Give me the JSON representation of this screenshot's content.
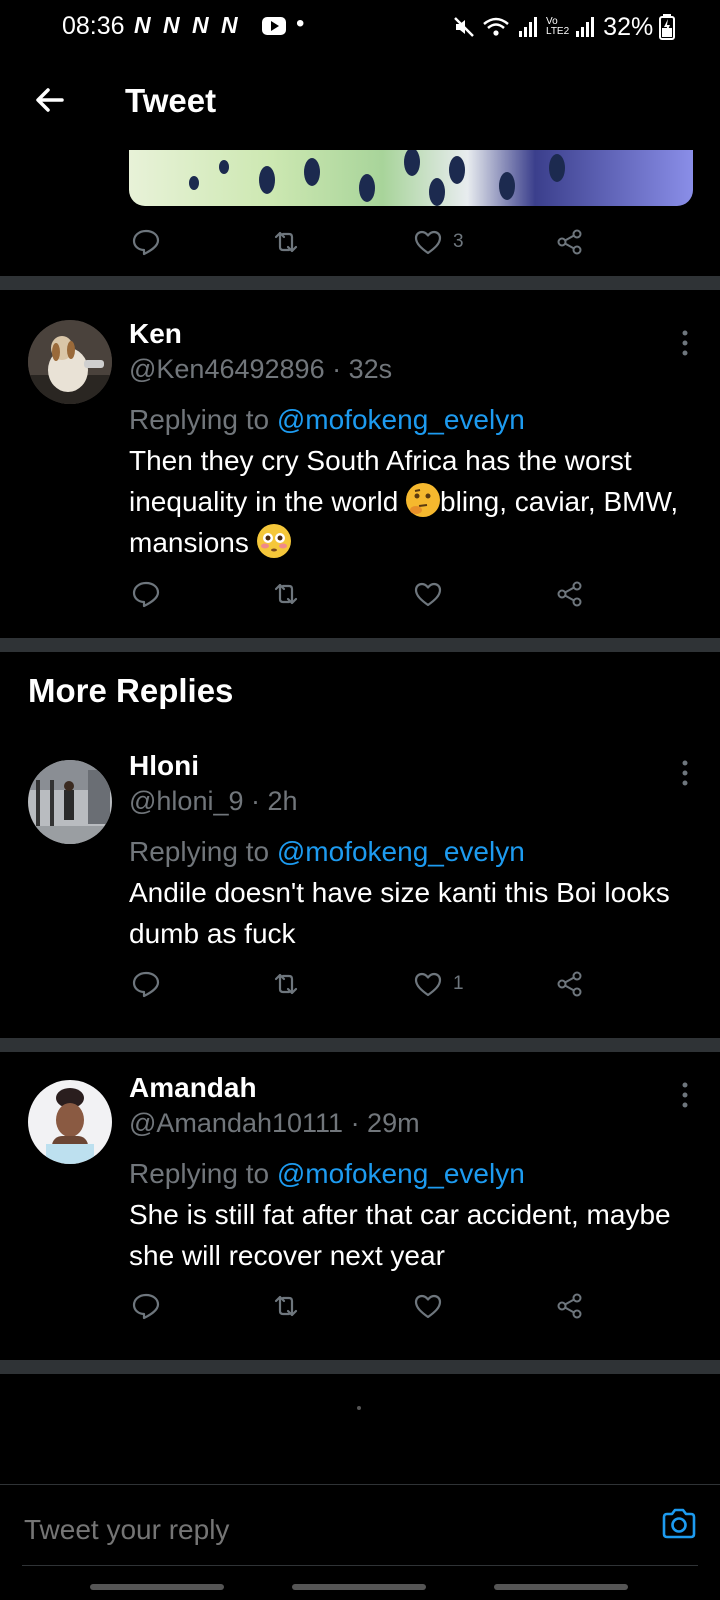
{
  "status_bar": {
    "time": "08:36",
    "notifications": "N N N N",
    "battery": "32%"
  },
  "header": {
    "title": "Tweet"
  },
  "top_tweet": {
    "like_count": "3"
  },
  "replies": [
    {
      "name": "Ken",
      "handle": "@Ken46492896 · 32s",
      "replying_prefix": "Replying to ",
      "mention": "@mofokeng_evelyn",
      "text_1": "Then they cry South Africa has the worst inequality in the world ",
      "text_2": "bling, caviar, BMW, mansions ",
      "like_count": ""
    },
    {
      "name": "Hloni",
      "handle": "@hloni_9 · 2h",
      "replying_prefix": "Replying to ",
      "mention": "@mofokeng_evelyn",
      "text": "Andile doesn't have size kanti this Boi looks dumb as fuck",
      "like_count": "1"
    },
    {
      "name": "Amandah",
      "handle": "@Amandah10111 · 29m",
      "replying_prefix": "Replying to ",
      "mention": "@mofokeng_evelyn",
      "text": "She is still fat after that car accident, maybe she will recover next year",
      "like_count": ""
    }
  ],
  "more_replies_heading": "More Replies",
  "compose": {
    "placeholder": "Tweet your reply"
  },
  "icons": {
    "reply": "speech-bubble-icon",
    "retweet": "retweet-icon",
    "like": "heart-icon",
    "share": "share-icon",
    "camera": "camera-icon"
  },
  "colors": {
    "accent": "#1d9bf0",
    "muted": "#71767b",
    "divider": "#2f3336"
  }
}
